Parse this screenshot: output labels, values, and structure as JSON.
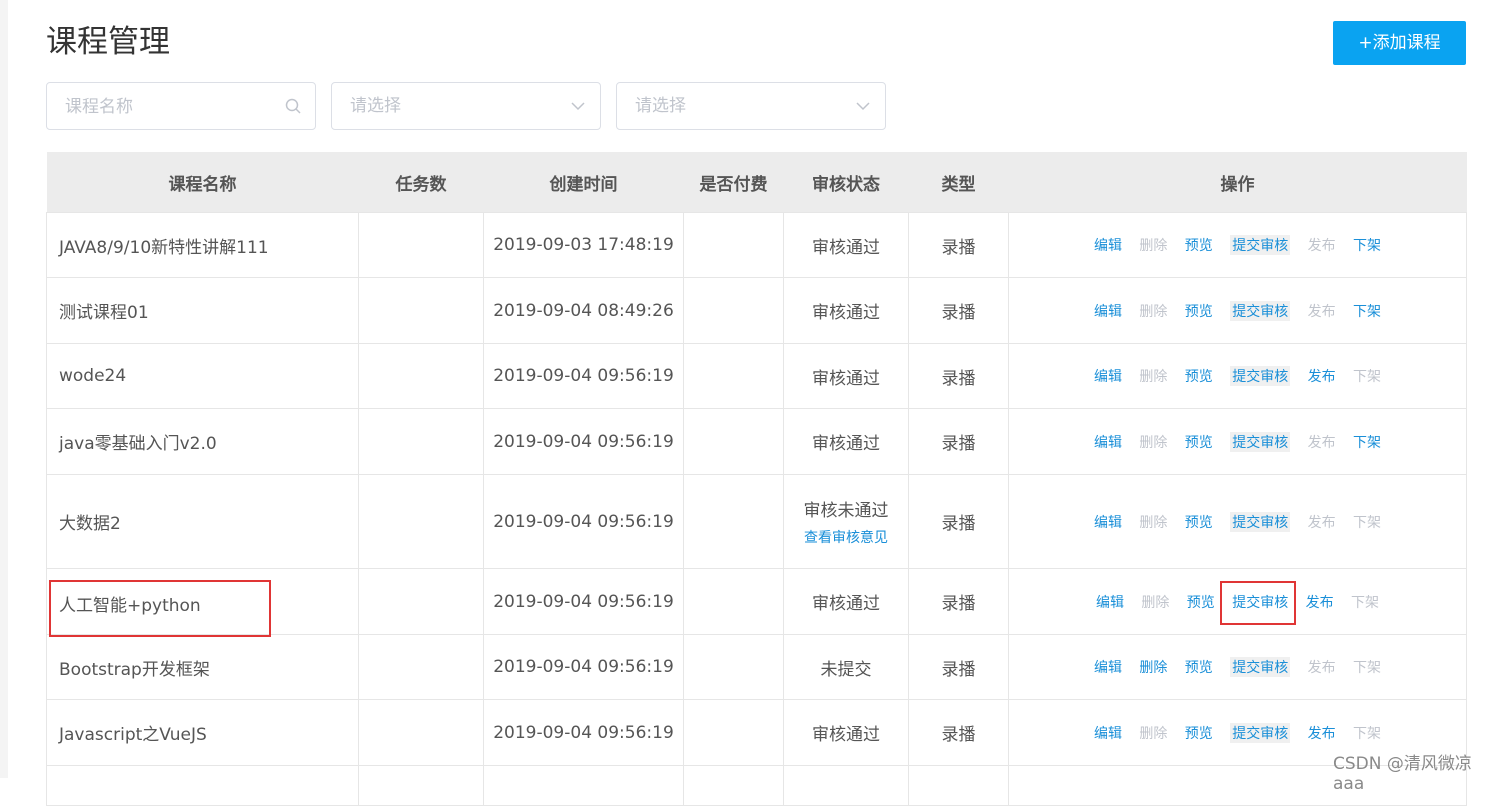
{
  "page": {
    "title": "课程管理",
    "add_button_label": "+添加课程"
  },
  "filters": {
    "course_name_placeholder": "课程名称",
    "select1_placeholder": "请选择",
    "select2_placeholder": "请选择"
  },
  "table": {
    "headers": [
      "课程名称",
      "任务数",
      "创建时间",
      "是否付费",
      "审核状态",
      "类型",
      "操作"
    ],
    "rows": [
      {
        "name": "JAVA8/9/10新特性讲解111",
        "tasks": "",
        "created": "2019-09-03 17:48:19",
        "paid": "",
        "status": "审核通过",
        "status_link": "",
        "type": "录播",
        "ops": {
          "edit": "编辑",
          "delete": "删除",
          "preview": "预览",
          "submit": "提交审核",
          "publish": "发布",
          "offline": "下架"
        }
      },
      {
        "name": "测试课程01",
        "tasks": "",
        "created": "2019-09-04 08:49:26",
        "paid": "",
        "status": "审核通过",
        "status_link": "",
        "type": "录播",
        "ops": {
          "edit": "编辑",
          "delete": "删除",
          "preview": "预览",
          "submit": "提交审核",
          "publish": "发布",
          "offline": "下架"
        }
      },
      {
        "name": "wode24",
        "tasks": "",
        "created": "2019-09-04 09:56:19",
        "paid": "",
        "status": "审核通过",
        "status_link": "",
        "type": "录播",
        "ops": {
          "edit": "编辑",
          "delete": "删除",
          "preview": "预览",
          "submit": "提交审核",
          "publish": "发布",
          "offline": "下架"
        }
      },
      {
        "name": "java零基础入门v2.0",
        "tasks": "",
        "created": "2019-09-04 09:56:19",
        "paid": "",
        "status": "审核通过",
        "status_link": "",
        "type": "录播",
        "ops": {
          "edit": "编辑",
          "delete": "删除",
          "preview": "预览",
          "submit": "提交审核",
          "publish": "发布",
          "offline": "下架"
        }
      },
      {
        "name": "大数据2",
        "tasks": "",
        "created": "2019-09-04 09:56:19",
        "paid": "",
        "status": "审核未通过",
        "status_link": "查看审核意见",
        "type": "录播",
        "ops": {
          "edit": "编辑",
          "delete": "删除",
          "preview": "预览",
          "submit": "提交审核",
          "publish": "发布",
          "offline": "下架"
        }
      },
      {
        "name": "人工智能+python",
        "tasks": "",
        "created": "2019-09-04 09:56:19",
        "paid": "",
        "status": "审核通过",
        "status_link": "",
        "type": "录播",
        "ops": {
          "edit": "编辑",
          "delete": "删除",
          "preview": "预览",
          "submit": "提交审核",
          "publish": "发布",
          "offline": "下架"
        }
      },
      {
        "name": "Bootstrap开发框架",
        "tasks": "",
        "created": "2019-09-04 09:56:19",
        "paid": "",
        "status": "未提交",
        "status_link": "",
        "type": "录播",
        "ops": {
          "edit": "编辑",
          "delete": "删除",
          "preview": "预览",
          "submit": "提交审核",
          "publish": "发布",
          "offline": "下架"
        }
      },
      {
        "name": "Javascript之VueJS",
        "tasks": "",
        "created": "2019-09-04 09:56:19",
        "paid": "",
        "status": "审核通过",
        "status_link": "",
        "type": "录播",
        "ops": {
          "edit": "编辑",
          "delete": "删除",
          "preview": "预览",
          "submit": "提交审核",
          "publish": "发布",
          "offline": "下架"
        }
      }
    ]
  },
  "watermark": "CSDN @清风微凉 aaa",
  "colors": {
    "accent": "#0aa3f1",
    "link": "#1a8fd8",
    "disabled": "#c0c4cc",
    "highlight": "#e03535",
    "header_bg": "#ececec"
  }
}
